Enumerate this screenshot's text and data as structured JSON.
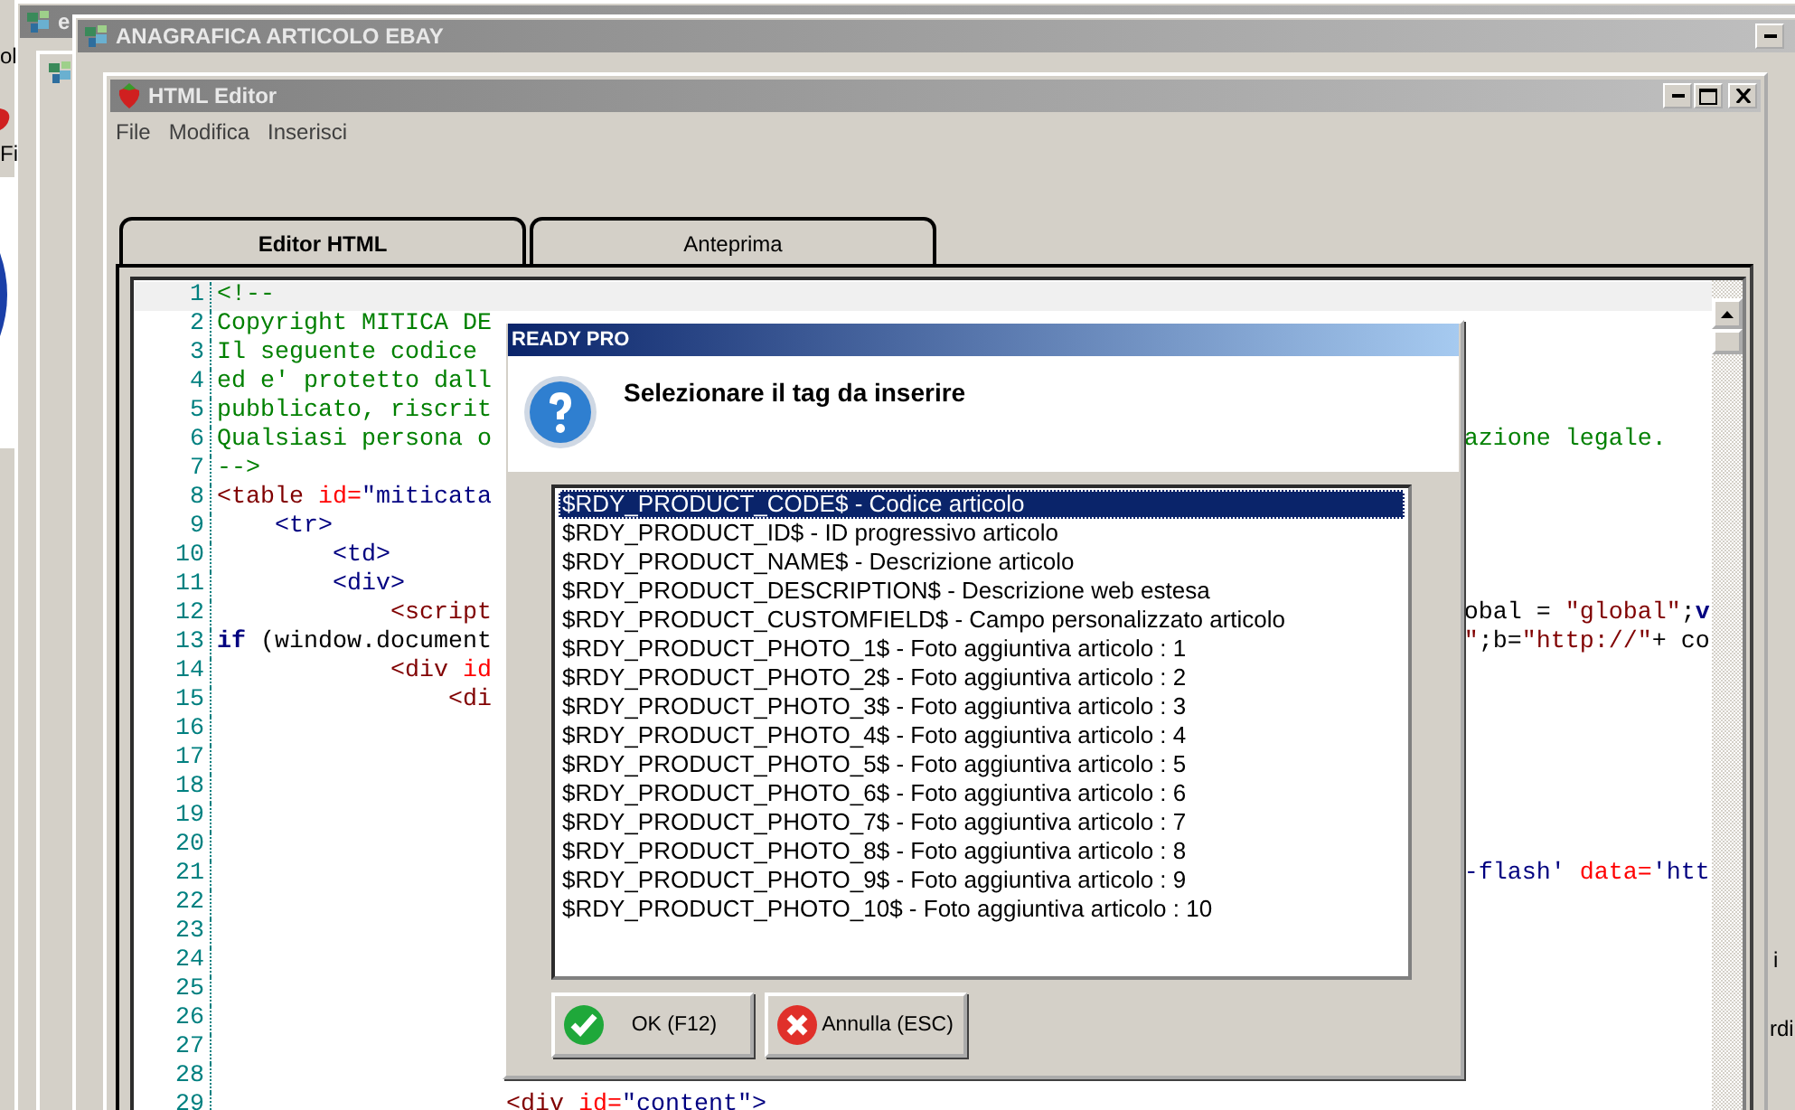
{
  "desktop": {
    "back_window_title": "e",
    "left_texts": [
      "ol",
      "Fi"
    ],
    "right_texts": [
      "i",
      "rdi"
    ]
  },
  "main_window": {
    "title": "ANAGRAFICA ARTICOLO EBAY"
  },
  "editor_window": {
    "title": "HTML Editor",
    "menu": [
      {
        "label": "File"
      },
      {
        "label": "Modifica"
      },
      {
        "label": "Inserisci"
      }
    ],
    "tabs": [
      {
        "label": "Editor HTML",
        "selected": true
      },
      {
        "label": "Anteprima",
        "selected": false
      }
    ],
    "code_lines": [
      {
        "number": "1",
        "current": true,
        "tokens": [
          {
            "kind": "comment",
            "text": "<!--"
          }
        ]
      },
      {
        "number": "2",
        "current": false,
        "tokens": [
          {
            "kind": "comment",
            "text": "Copyright MITICA DE"
          }
        ]
      },
      {
        "number": "3",
        "current": false,
        "tokens": [
          {
            "kind": "comment",
            "text": "Il seguente codice"
          }
        ]
      },
      {
        "number": "4",
        "current": false,
        "tokens": [
          {
            "kind": "comment",
            "text": "ed e' protetto dall"
          }
        ]
      },
      {
        "number": "5",
        "current": false,
        "tokens": [
          {
            "kind": "comment",
            "text": "pubblicato, riscrit"
          }
        ]
      },
      {
        "number": "6",
        "current": false,
        "tokens": [
          {
            "kind": "comment",
            "text": "Qualsiasi persona o"
          }
        ],
        "tail": [
          {
            "kind": "comment",
            "text": "azione legale."
          }
        ]
      },
      {
        "number": "7",
        "current": false,
        "tokens": [
          {
            "kind": "comment",
            "text": "-->"
          }
        ]
      },
      {
        "number": "8",
        "current": false,
        "tokens": [
          {
            "kind": "tag",
            "text": "<table"
          },
          {
            "kind": "attr",
            "text": " id="
          },
          {
            "kind": "value",
            "text": "\"miticata"
          }
        ]
      },
      {
        "number": "9",
        "current": false,
        "tokens": [
          {
            "kind": "element",
            "text": "    <tr>"
          }
        ]
      },
      {
        "number": "10",
        "current": false,
        "tokens": [
          {
            "kind": "element",
            "text": "        <td>"
          }
        ]
      },
      {
        "number": "11",
        "current": false,
        "tokens": [
          {
            "kind": "element",
            "text": "        <div>"
          }
        ]
      },
      {
        "number": "12",
        "current": false,
        "tokens": [
          {
            "kind": "tag",
            "text": "            <script"
          }
        ],
        "tail": [
          {
            "kind": "plain",
            "text": "obal = "
          },
          {
            "kind": "string",
            "text": "\"global\""
          },
          {
            "kind": "plain",
            "text": ";"
          },
          {
            "kind": "keyword",
            "text": "v"
          }
        ]
      },
      {
        "number": "13",
        "current": false,
        "tokens": [
          {
            "kind": "keyword",
            "text": "if"
          },
          {
            "kind": "plain",
            "text": " (window.document"
          }
        ],
        "tail": [
          {
            "kind": "string",
            "text": "\""
          },
          {
            "kind": "plain",
            "text": ";b="
          },
          {
            "kind": "string",
            "text": "\"http://\""
          },
          {
            "kind": "plain",
            "text": "+ co"
          }
        ]
      },
      {
        "number": "14",
        "current": false,
        "tokens": [
          {
            "kind": "tag",
            "text": "            <div"
          },
          {
            "kind": "attr",
            "text": " id"
          }
        ]
      },
      {
        "number": "15",
        "current": false,
        "tokens": [
          {
            "kind": "tag",
            "text": "                <di"
          }
        ]
      },
      {
        "number": "16",
        "current": false
      },
      {
        "number": "17",
        "current": false
      },
      {
        "number": "18",
        "current": false
      },
      {
        "number": "19",
        "current": false
      },
      {
        "number": "20",
        "current": false
      },
      {
        "number": "21",
        "current": false,
        "tail": [
          {
            "kind": "value",
            "text": "-flash'"
          },
          {
            "kind": "attr",
            "text": " data="
          },
          {
            "kind": "value",
            "text": "'htt"
          }
        ]
      },
      {
        "number": "22",
        "current": false
      },
      {
        "number": "23",
        "current": false
      },
      {
        "number": "24",
        "current": false
      },
      {
        "number": "25",
        "current": false
      },
      {
        "number": "26",
        "current": false
      },
      {
        "number": "27",
        "current": false
      },
      {
        "number": "28",
        "current": false
      },
      {
        "number": "29",
        "current": false,
        "tokens": [
          {
            "kind": "tag",
            "text": "                    <div"
          },
          {
            "kind": "attr",
            "text": " id="
          },
          {
            "kind": "value",
            "text": "\"content\">"
          }
        ]
      }
    ]
  },
  "dialog": {
    "title": "READY PRO",
    "message": "Selezionare il tag da inserire",
    "items": [
      {
        "label": "$RDY_PRODUCT_CODE$ - Codice articolo",
        "selected": true
      },
      {
        "label": "$RDY_PRODUCT_ID$ - ID progressivo articolo",
        "selected": false
      },
      {
        "label": "$RDY_PRODUCT_NAME$ - Descrizione articolo",
        "selected": false
      },
      {
        "label": "$RDY_PRODUCT_DESCRIPTION$ - Descrizione web estesa",
        "selected": false
      },
      {
        "label": "$RDY_PRODUCT_CUSTOMFIELD$ - Campo personalizzato articolo",
        "selected": false
      },
      {
        "label": "$RDY_PRODUCT_PHOTO_1$ - Foto aggiuntiva articolo : 1",
        "selected": false
      },
      {
        "label": "$RDY_PRODUCT_PHOTO_2$ - Foto aggiuntiva articolo : 2",
        "selected": false
      },
      {
        "label": "$RDY_PRODUCT_PHOTO_3$ - Foto aggiuntiva articolo : 3",
        "selected": false
      },
      {
        "label": "$RDY_PRODUCT_PHOTO_4$ - Foto aggiuntiva articolo : 4",
        "selected": false
      },
      {
        "label": "$RDY_PRODUCT_PHOTO_5$ - Foto aggiuntiva articolo : 5",
        "selected": false
      },
      {
        "label": "$RDY_PRODUCT_PHOTO_6$ - Foto aggiuntiva articolo : 6",
        "selected": false
      },
      {
        "label": "$RDY_PRODUCT_PHOTO_7$ - Foto aggiuntiva articolo : 7",
        "selected": false
      },
      {
        "label": "$RDY_PRODUCT_PHOTO_8$ - Foto aggiuntiva articolo : 8",
        "selected": false
      },
      {
        "label": "$RDY_PRODUCT_PHOTO_9$ - Foto aggiuntiva articolo : 9",
        "selected": false
      },
      {
        "label": "$RDY_PRODUCT_PHOTO_10$ - Foto aggiuntiva articolo : 10",
        "selected": false
      }
    ],
    "buttons": [
      {
        "kind": "ok",
        "label": "OK (F12)"
      },
      {
        "kind": "cancel",
        "label": "Annulla (ESC)"
      }
    ]
  }
}
